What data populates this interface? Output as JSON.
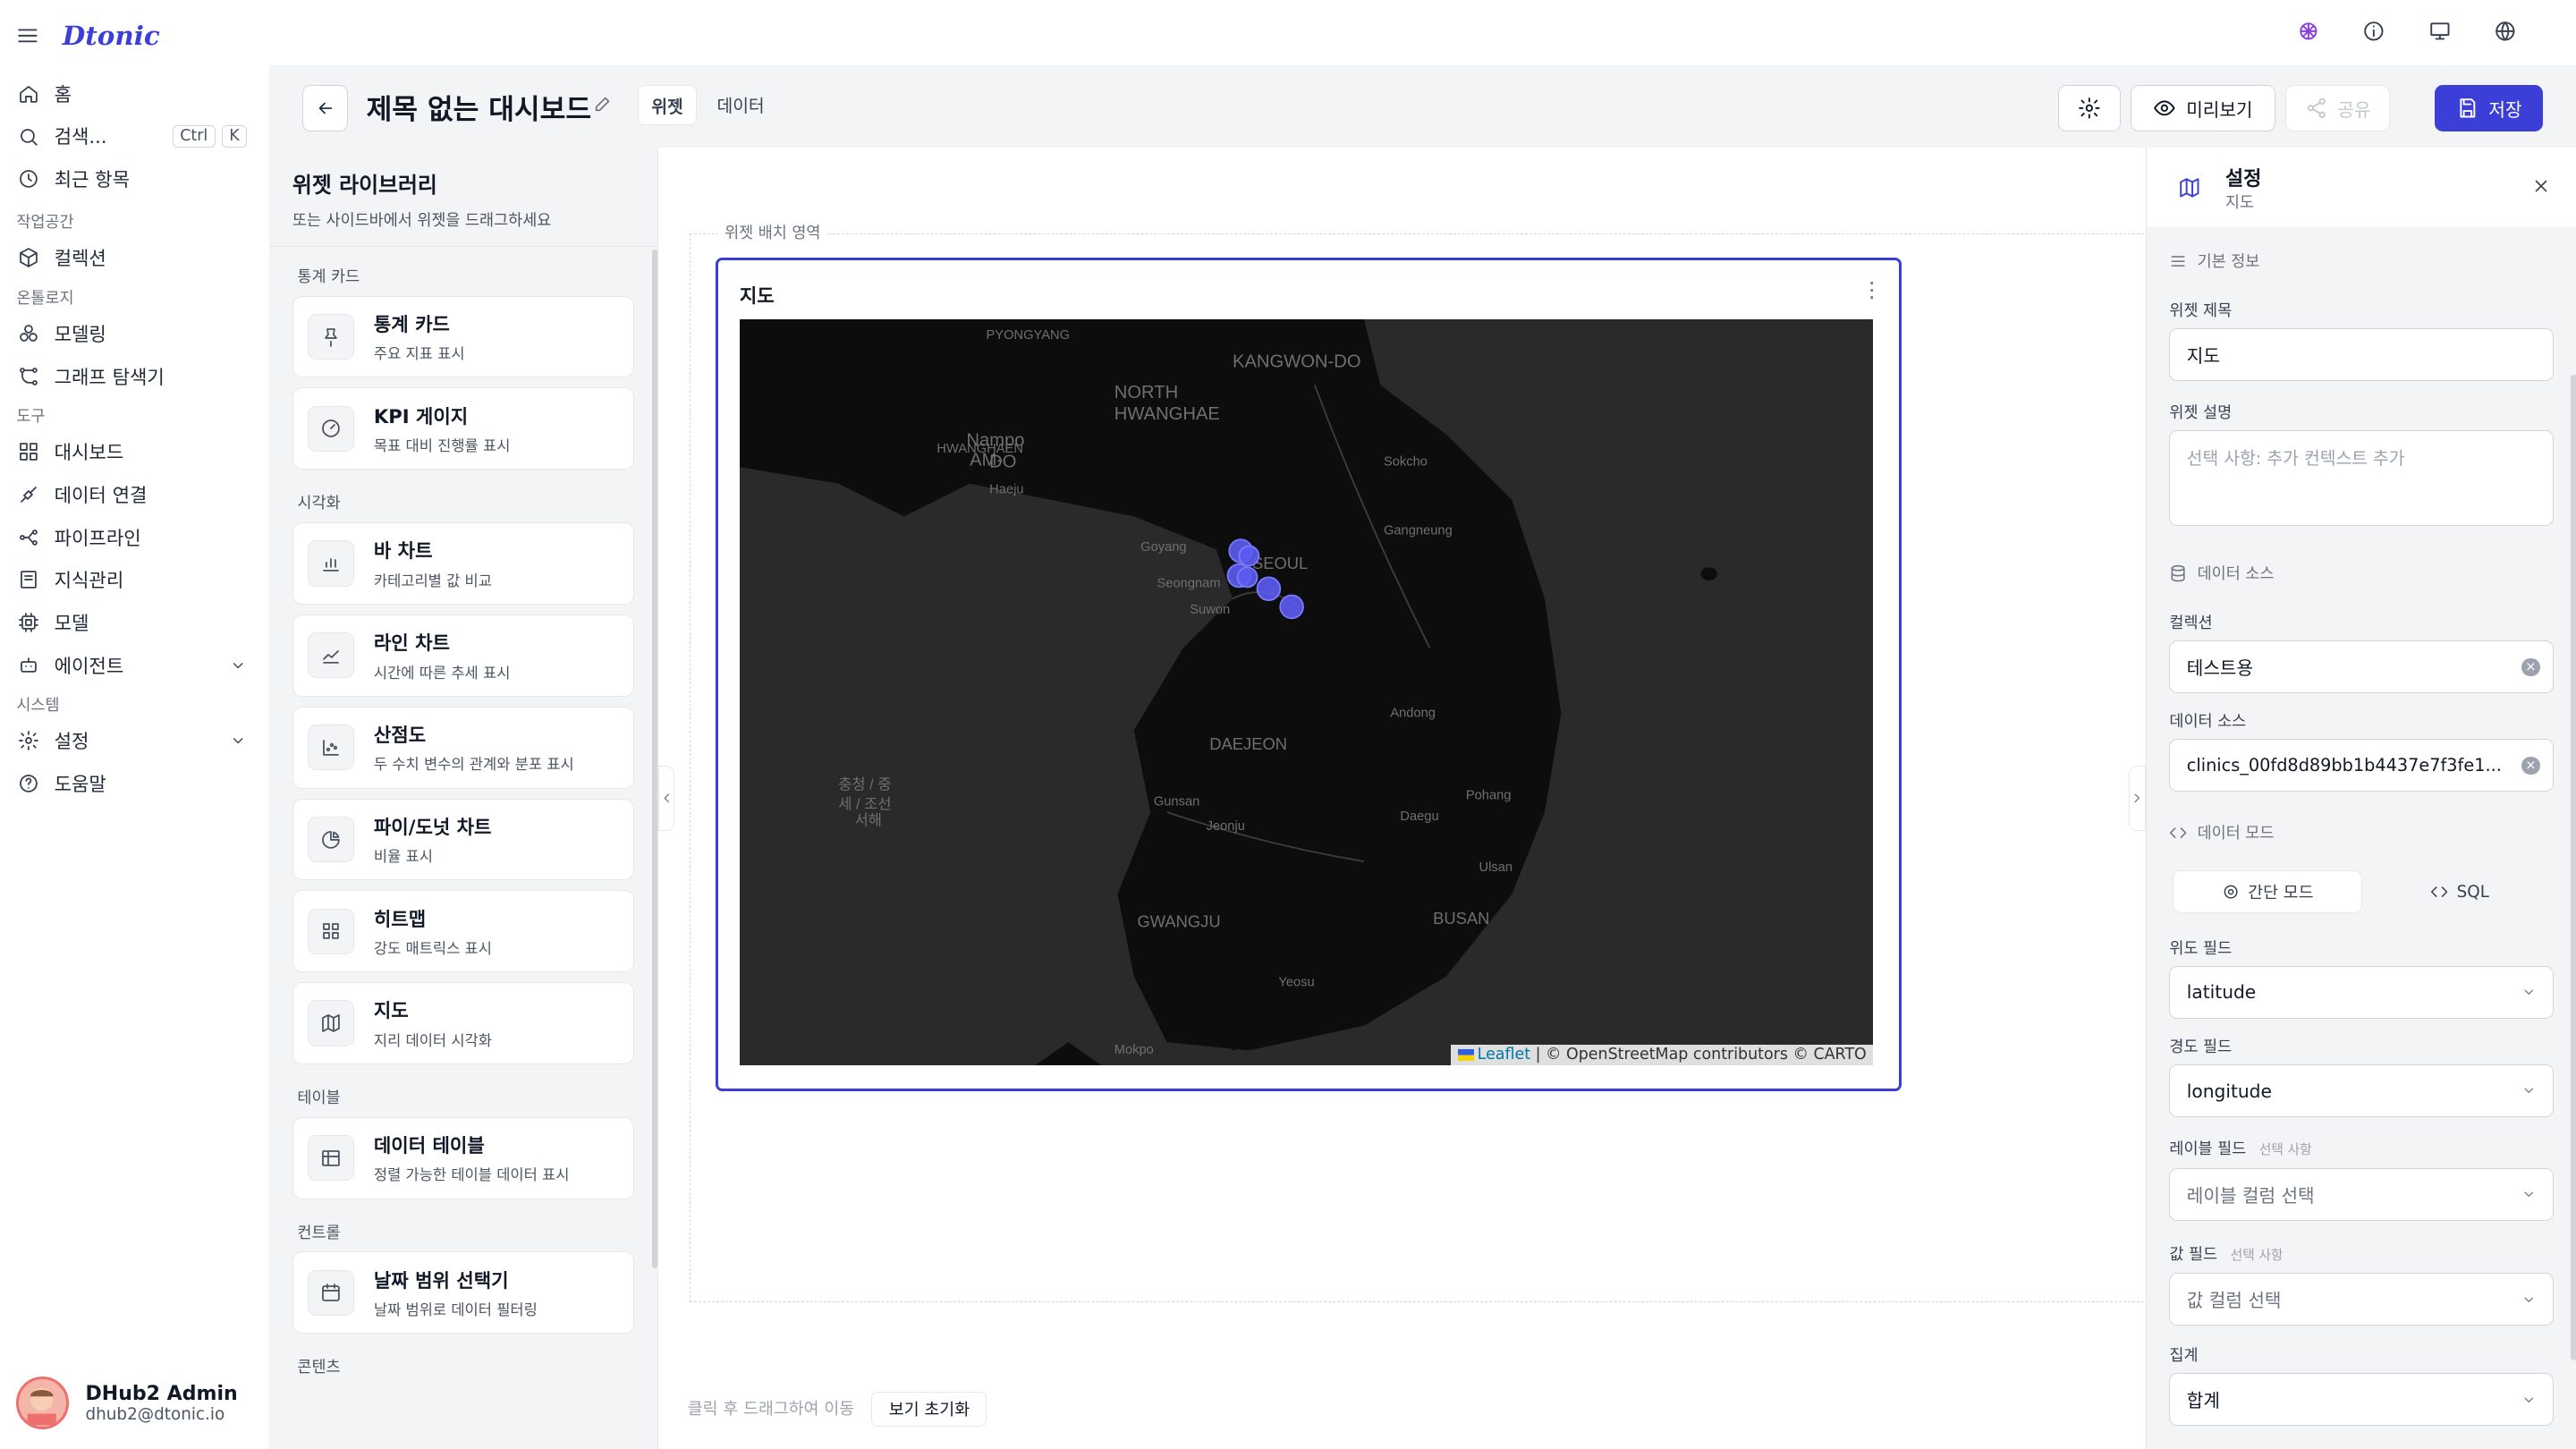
{
  "app": {
    "brand": "Dtonic"
  },
  "nav": {
    "home": "홈",
    "search": "검색...",
    "kbd1": "Ctrl",
    "kbd2": "K",
    "recent": "최근 항목",
    "sec_workspace": "작업공간",
    "collections": "컬렉션",
    "sec_ontology": "온톨로지",
    "modeling": "모델링",
    "graph": "그래프 탐색기",
    "sec_tools": "도구",
    "dashboard": "대시보드",
    "dataconn": "데이터 연결",
    "pipeline": "파이프라인",
    "knowledge": "지식관리",
    "model": "모델",
    "agent": "에이전트",
    "sec_system": "시스템",
    "settings": "설정",
    "help": "도움말"
  },
  "user": {
    "name": "DHub2 Admin",
    "email": "dhub2@dtonic.io"
  },
  "topbar": {
    "title": "제목 없는 대시보드",
    "tab_widgets": "위젯",
    "tab_data": "데이터",
    "preview": "미리보기",
    "share": "공유",
    "save": "저장"
  },
  "library": {
    "title": "위젯 라이브러리",
    "subtitle": "또는 사이드바에서 위젯을 드래그하세요",
    "sections": [
      {
        "label": "통계 카드",
        "items": [
          {
            "name": "통계 카드",
            "desc": "주요 지표 표시",
            "icon": "pin-icon"
          },
          {
            "name": "KPI 게이지",
            "desc": "목표 대비 진행률 표시",
            "icon": "gauge-icon"
          }
        ]
      },
      {
        "label": "시각화",
        "items": [
          {
            "name": "바 차트",
            "desc": "카테고리별 값 비교",
            "icon": "bar-chart-icon"
          },
          {
            "name": "라인 차트",
            "desc": "시간에 따른 추세 표시",
            "icon": "line-chart-icon"
          },
          {
            "name": "산점도",
            "desc": "두 수치 변수의 관계와 분포 표시",
            "icon": "scatter-icon"
          },
          {
            "name": "파이/도넛 차트",
            "desc": "비율 표시",
            "icon": "pie-icon"
          },
          {
            "name": "히트맵",
            "desc": "강도 매트릭스 표시",
            "icon": "grid-icon"
          },
          {
            "name": "지도",
            "desc": "지리 데이터 시각화",
            "icon": "map-icon"
          }
        ]
      },
      {
        "label": "테이블",
        "items": [
          {
            "name": "데이터 테이블",
            "desc": "정렬 가능한 테이블 데이터 표시",
            "icon": "table-icon"
          }
        ]
      },
      {
        "label": "컨트롤",
        "items": [
          {
            "name": "날짜 범위 선택기",
            "desc": "날짜 범위로 데이터 필터링",
            "icon": "calendar-icon"
          }
        ]
      },
      {
        "label": "콘텐츠",
        "items": []
      }
    ]
  },
  "canvas": {
    "zone_label": "위젯 배치 영역",
    "hint": "클릭 후 드래그하여 이동",
    "reset": "보기 초기화"
  },
  "widget": {
    "title": "지도",
    "more": "⋮",
    "map": {
      "attribution_link": "Leaflet",
      "attribution_text": "| © OpenStreetMap contributors © CARTO",
      "labels": [
        "PYONGYANG",
        "KANGWON-DO",
        "NORTH",
        "HWANGHAE",
        "Nampo",
        "HWANGHAEN",
        "AM-",
        "DO",
        "Haeju",
        "Sokcho",
        "Goyang",
        "SEOUL",
        "Seongnam",
        "Suwon",
        "Gangneung",
        "Andong",
        "DAEJEON",
        "Pohang",
        "Daegu",
        "Ulsan",
        "Gunsan",
        "Jeonju",
        "BUSAN",
        "GWANGJU",
        "Mokpo",
        "Yeosu",
        "충청 / 중",
        "세 / 조선",
        "서해"
      ],
      "accent": "#5b5cf0"
    }
  },
  "settings": {
    "title": "설정",
    "subtitle": "지도",
    "grp_basic": "기본 정보",
    "lbl_title": "위젯 제목",
    "val_title": "지도",
    "lbl_desc": "위젯 설명",
    "ph_desc": "선택 사항: 추가 컨텍스트 추가",
    "grp_source": "데이터 소스",
    "lbl_collection": "컬렉션",
    "val_collection": "테스트용",
    "lbl_datasource": "데이터 소스",
    "val_datasource": "clinics_00fd8d89bb1b4437e7f3fe1...",
    "grp_mode": "데이터 모드",
    "mode_simple": "간단 모드",
    "mode_sql": "SQL",
    "lbl_lat": "위도 필드",
    "val_lat": "latitude",
    "lbl_lng": "경도 필드",
    "val_lng": "longitude",
    "lbl_label": "레이블 필드",
    "opt": "선택 사항",
    "val_label": "레이블 컬럼 선택",
    "lbl_value": "값 필드",
    "val_value": "값 컬럼 선택",
    "lbl_agg": "집계",
    "val_agg": "합계"
  },
  "colors": {
    "accent": "#3b3fd8",
    "map_bg": "#2b2b2b"
  }
}
